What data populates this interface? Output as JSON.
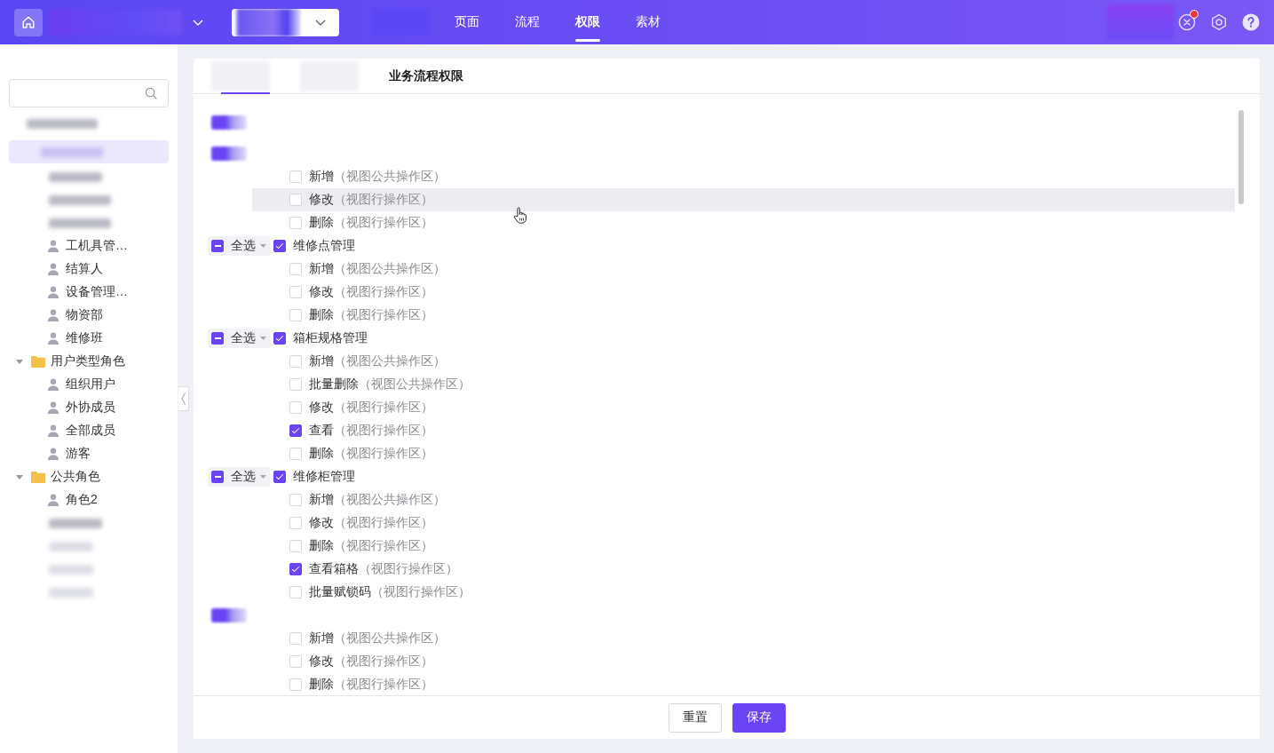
{
  "topbar": {
    "nav": [
      {
        "label": "页面",
        "selected": false
      },
      {
        "label": "流程",
        "selected": false
      },
      {
        "label": "权限",
        "selected": true
      },
      {
        "label": "素材",
        "selected": false
      }
    ],
    "notification_badge": true
  },
  "sidebar": {
    "tree": [
      {
        "kind": "folder",
        "children": [
          {
            "kind": "role",
            "label": "工机具管…"
          },
          {
            "kind": "role",
            "label": "结算人"
          },
          {
            "kind": "role",
            "label": "设备管理…"
          },
          {
            "kind": "role",
            "label": "物资部"
          },
          {
            "kind": "role",
            "label": "维修班"
          }
        ]
      },
      {
        "kind": "folder",
        "label": "用户类型角色",
        "expanded": true,
        "children": [
          {
            "kind": "role",
            "label": "组织用户"
          },
          {
            "kind": "role",
            "label": "外协成员"
          },
          {
            "kind": "role",
            "label": "全部成员"
          },
          {
            "kind": "role",
            "label": "游客"
          }
        ]
      },
      {
        "kind": "folder",
        "label": "公共角色",
        "expanded": true,
        "children": [
          {
            "kind": "role",
            "label": "角色2"
          }
        ]
      }
    ]
  },
  "panel": {
    "tabs": [
      {
        "selected": true
      },
      {
        "selected": false
      },
      {
        "label": "业务流程权限",
        "selected": false
      }
    ],
    "groups": [
      {
        "items": [
          {
            "name": "新增",
            "note": "（视图公共操作区）",
            "checked": false,
            "hovered": false
          },
          {
            "name": "修改",
            "note": "（视图行操作区）",
            "checked": false,
            "hovered": true
          },
          {
            "name": "删除",
            "note": "（视图行操作区）",
            "checked": false,
            "hovered": false
          }
        ]
      },
      {
        "select_all": {
          "label": "全选",
          "indeterminate": true
        },
        "name": "维修点管理",
        "checked": true,
        "items": [
          {
            "name": "新增",
            "note": "（视图公共操作区）",
            "checked": false,
            "hovered": false
          },
          {
            "name": "修改",
            "note": "（视图行操作区）",
            "checked": false,
            "hovered": false
          },
          {
            "name": "删除",
            "note": "（视图行操作区）",
            "checked": false,
            "hovered": false
          }
        ]
      },
      {
        "select_all": {
          "label": "全选",
          "indeterminate": true
        },
        "name": "箱柜规格管理",
        "checked": true,
        "items": [
          {
            "name": "新增",
            "note": "（视图公共操作区）",
            "checked": false,
            "hovered": false
          },
          {
            "name": "批量删除",
            "note": "（视图公共操作区）",
            "checked": false,
            "hovered": false
          },
          {
            "name": "修改",
            "note": "（视图行操作区）",
            "checked": false,
            "hovered": false
          },
          {
            "name": "查看",
            "note": "（视图行操作区）",
            "checked": true,
            "hovered": false
          },
          {
            "name": "删除",
            "note": "（视图行操作区）",
            "checked": false,
            "hovered": false
          }
        ]
      },
      {
        "select_all": {
          "label": "全选",
          "indeterminate": true
        },
        "name": "维修柜管理",
        "checked": true,
        "items": [
          {
            "name": "新增",
            "note": "（视图公共操作区）",
            "checked": false,
            "hovered": false
          },
          {
            "name": "修改",
            "note": "（视图行操作区）",
            "checked": false,
            "hovered": false
          },
          {
            "name": "删除",
            "note": "（视图行操作区）",
            "checked": false,
            "hovered": false
          },
          {
            "name": "查看箱格",
            "note": "（视图行操作区）",
            "checked": true,
            "hovered": false
          },
          {
            "name": "批量赋锁码",
            "note": "（视图行操作区）",
            "checked": false,
            "hovered": false
          }
        ]
      },
      {
        "items": [
          {
            "name": "新增",
            "note": "（视图公共操作区）",
            "checked": false,
            "hovered": false
          },
          {
            "name": "修改",
            "note": "（视图行操作区）",
            "checked": false,
            "hovered": false
          },
          {
            "name": "删除",
            "note": "（视图行操作区）",
            "checked": false,
            "hovered": false
          }
        ]
      }
    ],
    "buttons": [
      {
        "label": "重置",
        "kind": "default"
      },
      {
        "label": "保存",
        "kind": "primary"
      }
    ]
  }
}
